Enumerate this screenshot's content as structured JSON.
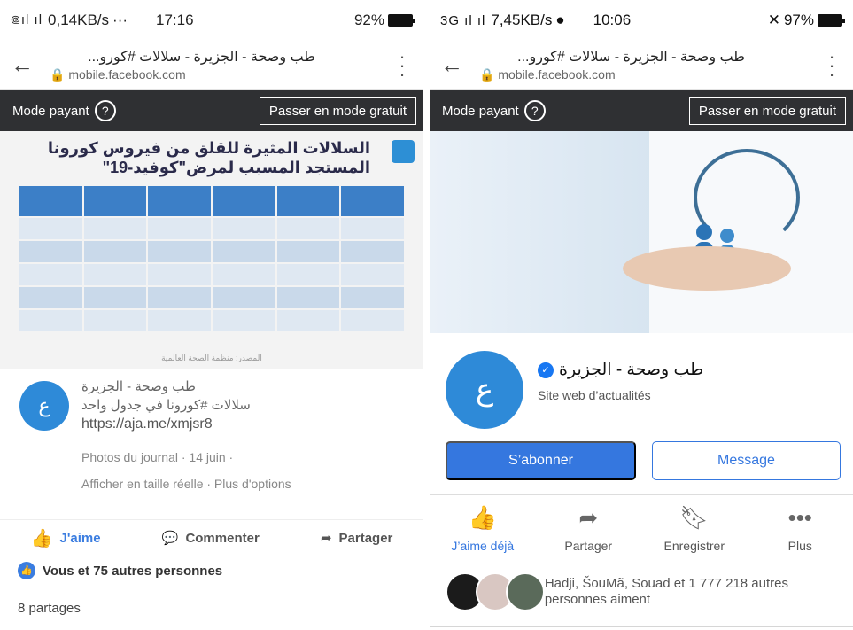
{
  "left": {
    "status": {
      "signal": "᪤ıl ıl",
      "speed": "0,14KB/s",
      "dots": "···",
      "time": "17:16",
      "battery": "92%"
    },
    "url": {
      "title": "طب وصحة - الجزيرة - سلالات #كورو...",
      "domain": "mobile.facebook.com"
    },
    "paybar": {
      "label": "Mode payant",
      "button": "Passer en mode gratuit"
    },
    "infographic": {
      "title": "السلالات المثيرة للقلق من فيروس كورونا المستجد المسبب لمرض\"كوفيد-19\"",
      "footer": "المصدر: منظمة الصحة العالمية"
    },
    "post": {
      "author": "طب وصحة - الجزيرة",
      "text": "سلالات #كورونا في جدول واحد",
      "link": "https://aja.me/xmjsr8",
      "meta": "Photos du journal · 14 juin ·",
      "options": "Afficher en taille réelle · Plus d'options"
    },
    "actions": {
      "like": "J'aime",
      "comment": "Commenter",
      "share": "Partager"
    },
    "likes": "Vous et 75 autres personnes",
    "shares": "8 partages"
  },
  "right": {
    "status": {
      "signal": "3G ıl ıl",
      "speed": "7,45KB/s",
      "time": "10:06",
      "battery": "97%"
    },
    "url": {
      "title": "طب وصحة - الجزيرة - سلالات #كورو...",
      "domain": "mobile.facebook.com"
    },
    "paybar": {
      "label": "Mode payant",
      "button": "Passer en mode gratuit"
    },
    "page": {
      "name": "طب وصحة - الجزيرة",
      "category": "Site web d’actualités"
    },
    "buttons": {
      "subscribe": "S’abonner",
      "message": "Message"
    },
    "icons": [
      {
        "label": "J’aime déjà",
        "icon": "thumbs-up-icon"
      },
      {
        "label": "Partager",
        "icon": "share-icon"
      },
      {
        "label": "Enregistrer",
        "icon": "bookmark-icon"
      },
      {
        "label": "Plus",
        "icon": "more-icon"
      }
    ],
    "friends_text": "Hadji, ŠouMã, Souad et 1 777 218 autres personnes aiment"
  }
}
